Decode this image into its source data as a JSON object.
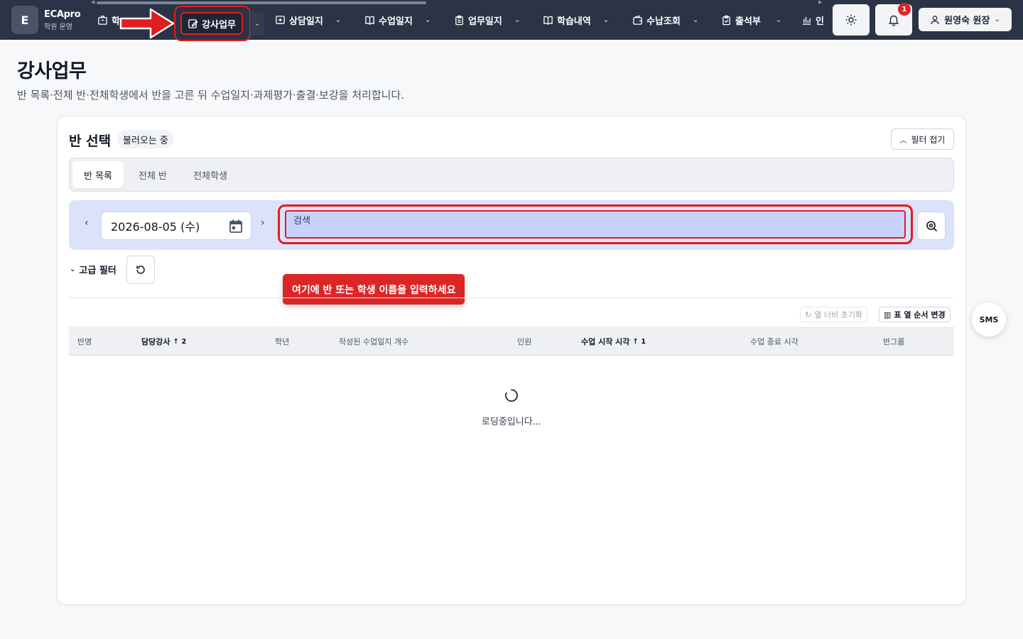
{
  "app": {
    "brand_initial": "E",
    "brand_name": "ECApro",
    "brand_sub": "학원 운영"
  },
  "nav": {
    "first_partial": "학",
    "active": "강사업무",
    "items": [
      {
        "label": "상담일지",
        "icon": "chat-plus-icon"
      },
      {
        "label": "수업일지",
        "icon": "book-open-icon"
      },
      {
        "label": "업무일지",
        "icon": "clipboard-icon"
      },
      {
        "label": "학습내역",
        "icon": "book-open-icon"
      },
      {
        "label": "수납조회",
        "icon": "wallet-icon"
      },
      {
        "label": "출석부",
        "icon": "clipboard-check-icon"
      },
      {
        "label": "인",
        "icon": "bar-chart-icon"
      }
    ],
    "notification_count": "1",
    "user": "원영숙 원장"
  },
  "page": {
    "title": "강사업무",
    "subtitle": "반 목록·전체 반·전체학생에서 반을 고른 뒤 수업일지·과제평가·출결·보강을 처리합니다."
  },
  "card": {
    "title": "반 선택",
    "status_badge": "불러오는 중",
    "fold_button": "필터 접기",
    "tabs": [
      "반 목록",
      "전체 반",
      "전체학생"
    ],
    "date": "2026-08-05 (수)",
    "search_placeholder": "검색",
    "advanced_filter": "고급 필터",
    "tooltip": "여기에 반 또는 학생 이름을 입력하세요",
    "col_width_reset": "열 너비 초기화",
    "col_order_change": "표 열 순서 변경",
    "columns": [
      {
        "label": "반명"
      },
      {
        "label": "담당강사",
        "sort": "↑ 2"
      },
      {
        "label": "학년"
      },
      {
        "label": "작성된 수업일지 개수"
      },
      {
        "label": "인원"
      },
      {
        "label": "수업 시작 시각",
        "sort": "↑ 1"
      },
      {
        "label": "수업 종료 시각"
      },
      {
        "label": "반그룹"
      }
    ],
    "loading_text": "로딩중입니다..."
  },
  "floating": {
    "sms": "SMS"
  },
  "colors": {
    "nav_bg": "#2b3346",
    "highlight": "#e11d1d",
    "search_row_bg": "#dbe2fc",
    "search_input_bg": "#c7d2fe"
  }
}
